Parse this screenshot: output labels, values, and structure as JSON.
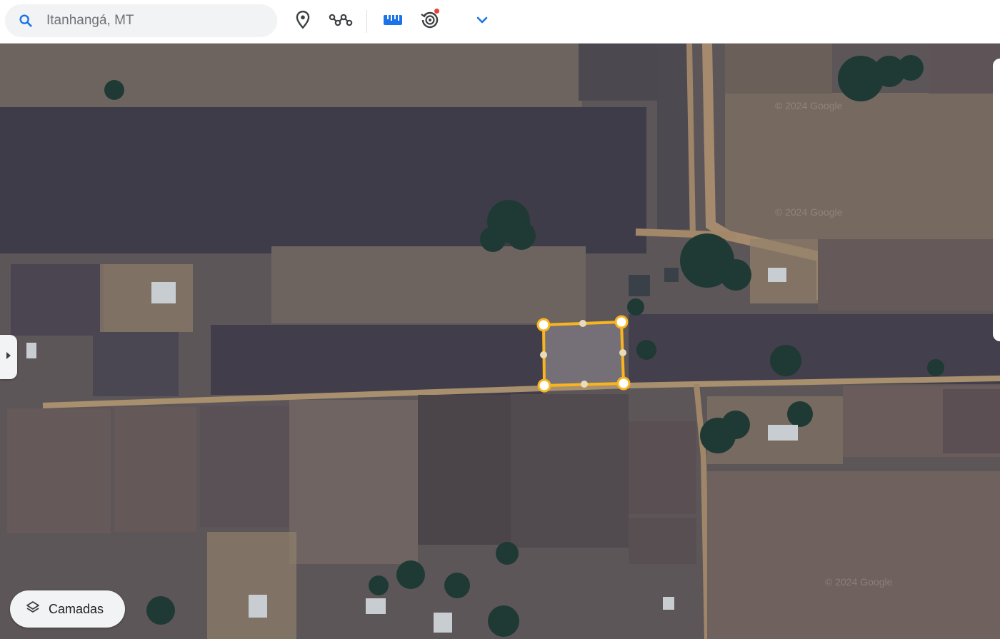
{
  "search": {
    "placeholder": "Itanhangá, MT"
  },
  "toolbar": {
    "icons": [
      "search-icon",
      "location-pin-icon",
      "path-icon",
      "ruler-icon",
      "history-icon",
      "chevron-down-icon"
    ],
    "accent_color": "#1a73e8"
  },
  "map": {
    "attribution": "© 2024 Google",
    "polygon_color": "#f9b51f"
  },
  "layers": {
    "label": "Camadas"
  }
}
